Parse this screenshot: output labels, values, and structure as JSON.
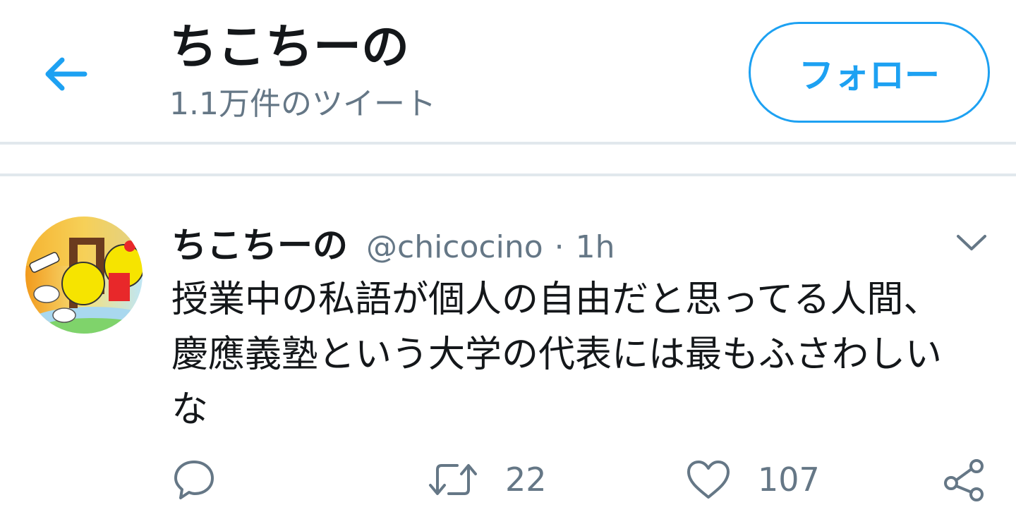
{
  "header": {
    "title": "ちこちーの",
    "subtitle": "1.1万件のツイート",
    "follow_label": "フォロー"
  },
  "tweet": {
    "name": "ちこちーの",
    "handle": "@chicocino",
    "separator": "·",
    "time": "1h",
    "text": "授業中の私語が個人の自由だと思ってる人間、慶應義塾という大学の代表には最もふさわしいな",
    "retweet_count": "22",
    "like_count": "107"
  },
  "icons": {
    "back": "back-arrow-icon",
    "caret": "chevron-down-icon",
    "reply": "reply-icon",
    "retweet": "retweet-icon",
    "like": "heart-icon",
    "share": "share-icon"
  },
  "colors": {
    "accent": "#1da1f2",
    "text_primary": "#14171a",
    "text_secondary": "#657786",
    "divider": "#e1e8ed"
  }
}
